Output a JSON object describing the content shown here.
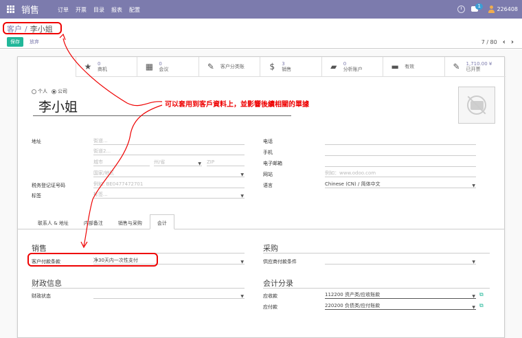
{
  "topbar": {
    "app_title": "销售",
    "menu": [
      "订单",
      "开票",
      "目录",
      "报表",
      "配置"
    ],
    "msg_count": "1",
    "user": "226408"
  },
  "breadcrumb": {
    "parent": "客户",
    "sep": "/",
    "current": "李小姐"
  },
  "buttons": {
    "save": "保存",
    "discard": "放弃"
  },
  "pager": {
    "text": "7 / 80",
    "prev": "‹",
    "next": "›"
  },
  "stats": [
    {
      "icon": "★",
      "num": "0",
      "label": "商机"
    },
    {
      "icon": "▦",
      "num": "0",
      "label": "会议"
    },
    {
      "icon": "✎",
      "num": "",
      "label": "客户分类账"
    },
    {
      "icon": "$",
      "num": "3",
      "label": "销售"
    },
    {
      "icon": "▰",
      "num": "0",
      "label": "分析账户"
    },
    {
      "icon": "▬",
      "num": "",
      "label": "有效"
    },
    {
      "icon": "✎",
      "num": "1,710.00 ¥",
      "label": "已开票"
    }
  ],
  "partner_type": {
    "person": "个人",
    "company": "公司"
  },
  "partner_name": "李小姐",
  "annotation": "可以套用到客戶資料上，並影響後續相關的單據",
  "form": {
    "address_label": "地址",
    "street_ph": "街道...",
    "street2_ph": "街道2...",
    "city_ph": "城市",
    "state_ph": "州/省",
    "zip_ph": "ZIP",
    "country_ph": "国家/地区",
    "vat_label": "税务登记证号码",
    "vat_ph": "例如: BE0477472701",
    "tags_label": "标签",
    "tags_ph": "标签...",
    "phone_label": "电话",
    "mobile_label": "手机",
    "email_label": "电子邮箱",
    "website_label": "网站",
    "website_ph": "例如：www.odoo.com",
    "lang_label": "语言",
    "lang_value": "Chinese (CN) / 简体中文"
  },
  "tabs": [
    "联系人 & 地址",
    "内部备注",
    "销售与采购",
    "会计"
  ],
  "accounting": {
    "sales_title": "销售",
    "payment_term_label": "客户付款条款",
    "payment_term_value": "净30天内一次性支付",
    "purchase_title": "采购",
    "supplier_term_label": "供应商付款条件",
    "fiscal_title": "财政信息",
    "fiscal_pos_label": "财政状态",
    "entries_title": "会计分录",
    "receivable_label": "应收款",
    "receivable_value": "112200 资产类/应收账款",
    "payable_label": "应付款",
    "payable_value": "220200 负债类/应付账款"
  }
}
